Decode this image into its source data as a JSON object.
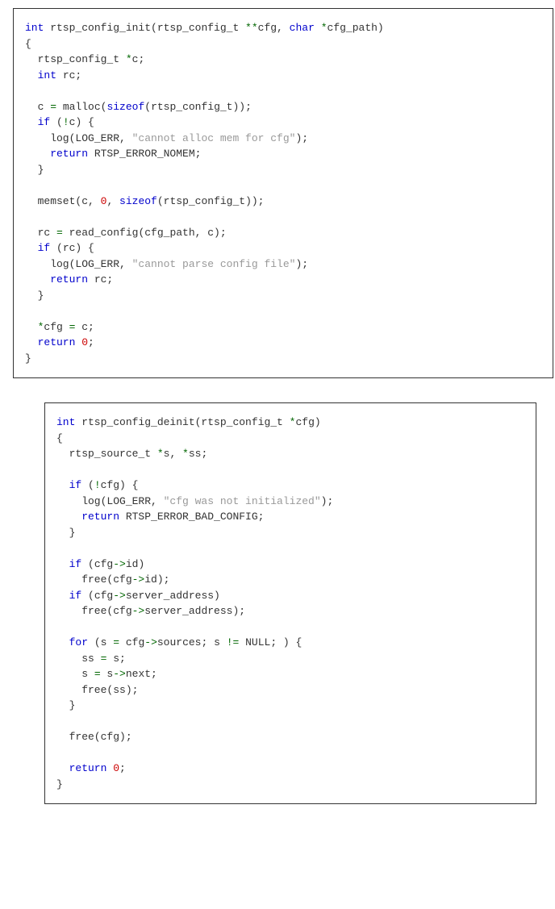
{
  "box1": {
    "l1_kw1": "int",
    "l1_id": " rtsp_config_init(rtsp_config_t ",
    "l1_op1": "**",
    "l1_id2": "cfg, ",
    "l1_kw2": "char",
    "l1_id3": " ",
    "l1_op2": "*",
    "l1_id4": "cfg_path)",
    "l2": "{",
    "l3a": "  rtsp_config_t ",
    "l3op": "*",
    "l3b": "c;",
    "l4kw": "  int",
    "l4b": " rc;",
    "l5": "",
    "l6a": "  c ",
    "l6op": "=",
    "l6b": " malloc(",
    "l6kw": "sizeof",
    "l6c": "(rtsp_config_t));",
    "l7kw": "  if",
    "l7b": " (",
    "l7op": "!",
    "l7c": "c) {",
    "l8a": "    log(LOG_ERR, ",
    "l8str": "\"cannot alloc mem for cfg\"",
    "l8b": ");",
    "l9kw": "    return",
    "l9b": " RTSP_ERROR_NOMEM;",
    "l10": "  }",
    "l11": "",
    "l12a": "  memset(c, ",
    "l12num": "0",
    "l12b": ", ",
    "l12kw": "sizeof",
    "l12c": "(rtsp_config_t));",
    "l13": "",
    "l14a": "  rc ",
    "l14op": "=",
    "l14b": " read_config(cfg_path, c);",
    "l15kw": "  if",
    "l15b": " (rc) {",
    "l16a": "    log(LOG_ERR, ",
    "l16str": "\"cannot parse config file\"",
    "l16b": ");",
    "l17kw": "    return",
    "l17b": " rc;",
    "l18": "  }",
    "l19": "",
    "l20op": "  *",
    "l20a": "cfg ",
    "l20eq": "=",
    "l20b": " c;",
    "l21kw": "  return",
    "l21b": " ",
    "l21num": "0",
    "l21c": ";",
    "l22": "}"
  },
  "box2": {
    "l1kw": "int",
    "l1b": " rtsp_config_deinit(rtsp_config_t ",
    "l1op": "*",
    "l1c": "cfg)",
    "l2": "{",
    "l3a": "  rtsp_source_t ",
    "l3op1": "*",
    "l3b": "s, ",
    "l3op2": "*",
    "l3c": "ss;",
    "l4": "",
    "l5kw": "  if",
    "l5b": " (",
    "l5op": "!",
    "l5c": "cfg) {",
    "l6a": "    log(LOG_ERR, ",
    "l6str": "\"cfg was not initialized\"",
    "l6b": ");",
    "l7kw": "    return",
    "l7b": " RTSP_ERROR_BAD_CONFIG;",
    "l8": "  }",
    "l9": "",
    "l10kw": "  if",
    "l10b": " (cfg",
    "l10op": "->",
    "l10c": "id)",
    "l11a": "    free(cfg",
    "l11op": "->",
    "l11b": "id);",
    "l12kw": "  if",
    "l12b": " (cfg",
    "l12op": "->",
    "l12c": "server_address)",
    "l13a": "    free(cfg",
    "l13op": "->",
    "l13b": "server_address);",
    "l14": "",
    "l15kw": "  for",
    "l15b": " (s ",
    "l15eq": "=",
    "l15c": " cfg",
    "l15op": "->",
    "l15d": "sources; s ",
    "l15ne": "!=",
    "l15e": " NULL; ) {",
    "l16a": "    ss ",
    "l16op": "=",
    "l16b": " s;",
    "l17a": "    s ",
    "l17op": "=",
    "l17b": " s",
    "l17ar": "->",
    "l17c": "next;",
    "l18a": "    free(ss);",
    "l19": "  }",
    "l20": "",
    "l21": "  free(cfg);",
    "l22": "",
    "l23kw": "  return",
    "l23b": " ",
    "l23num": "0",
    "l23c": ";",
    "l24": "}"
  }
}
